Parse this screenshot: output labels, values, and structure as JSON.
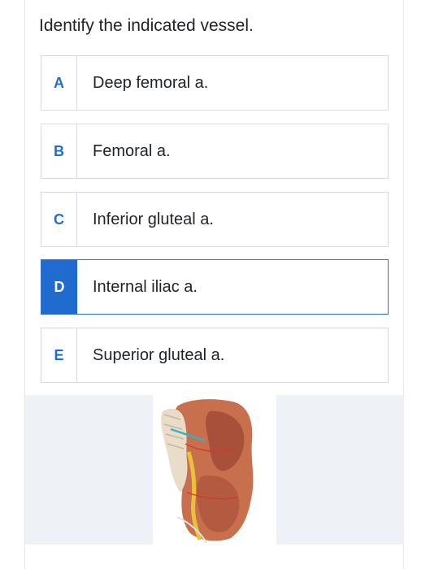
{
  "question": {
    "text": "Identify the indicated vessel."
  },
  "options": [
    {
      "letter": "A",
      "label": "Deep femoral a.",
      "selected": false
    },
    {
      "letter": "B",
      "label": "Femoral a.",
      "selected": false
    },
    {
      "letter": "C",
      "label": "Inferior gluteal a.",
      "selected": false
    },
    {
      "letter": "D",
      "label": "Internal iliac a.",
      "selected": true
    },
    {
      "letter": "E",
      "label": "Superior gluteal a.",
      "selected": false
    }
  ],
  "figure": {
    "subject": "anatomical-illustration-posterior-pelvis-and-thigh",
    "pointer_color": "#2bb7c9"
  },
  "colors": {
    "accent": "#1f6bd0",
    "text": "#1f2328",
    "border": "#d7dbe0",
    "figure_bg": "#eef1f5"
  }
}
